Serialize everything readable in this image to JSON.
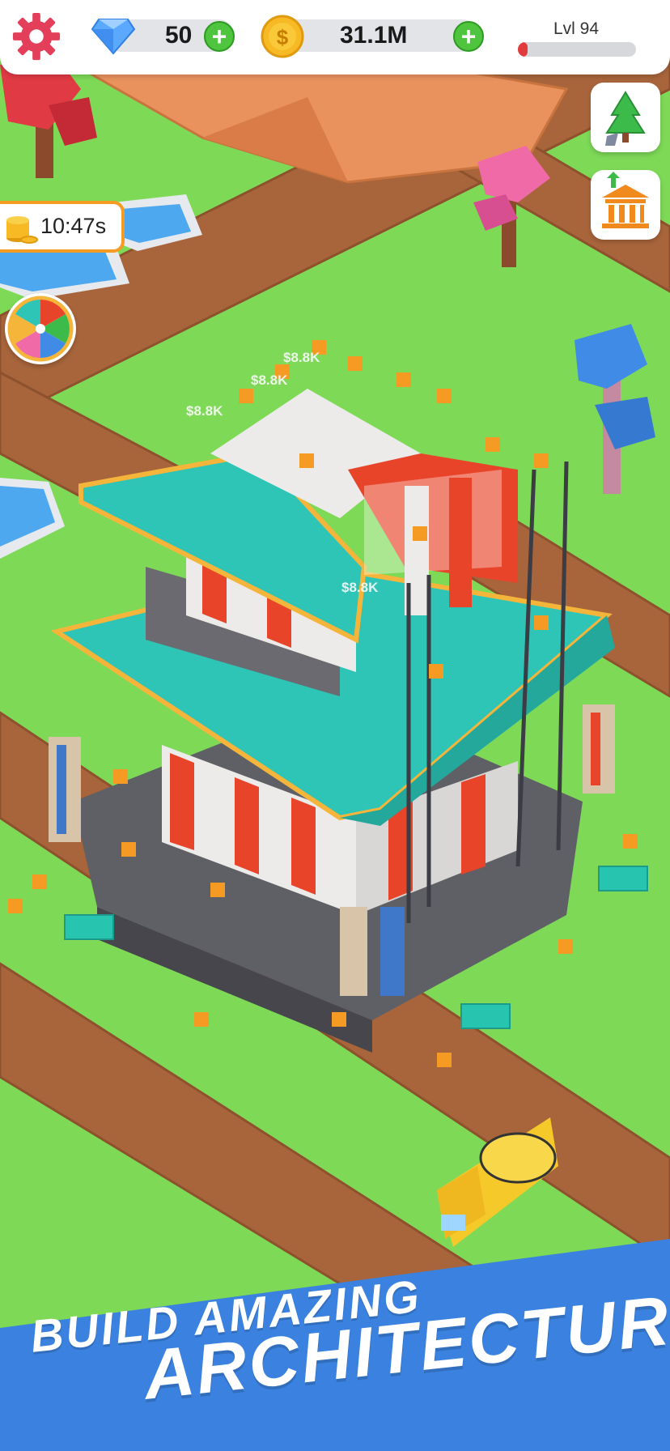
{
  "hud": {
    "gems": "50",
    "coins": "31.1M",
    "level_label": "Lvl 94",
    "level_progress": 0.08,
    "add_label": "+"
  },
  "boost_timer": "10:47s",
  "floating_texts": [
    "$8.8K",
    "$8.8K",
    "$8.8K",
    "$8.8K"
  ],
  "banner": {
    "line1": "BUILD AMAZING",
    "line2": "ARCHITECTURE"
  },
  "colors": {
    "grass": "#7ed957",
    "road": "#a0603a",
    "roof": "#2ec4b6",
    "wall_red": "#e8442a",
    "banner": "#3b82e0",
    "accent_orange": "#f59a23",
    "plus_green": "#4fc43e"
  },
  "icons": {
    "settings": "gear-icon",
    "gem": "diamond-icon",
    "coin": "dollar-coin-icon",
    "shop": "tree-shovel-icon",
    "upgrade": "bank-upgrade-icon",
    "spin": "spin-wheel-icon",
    "coins_stack": "coin-stack-icon"
  }
}
